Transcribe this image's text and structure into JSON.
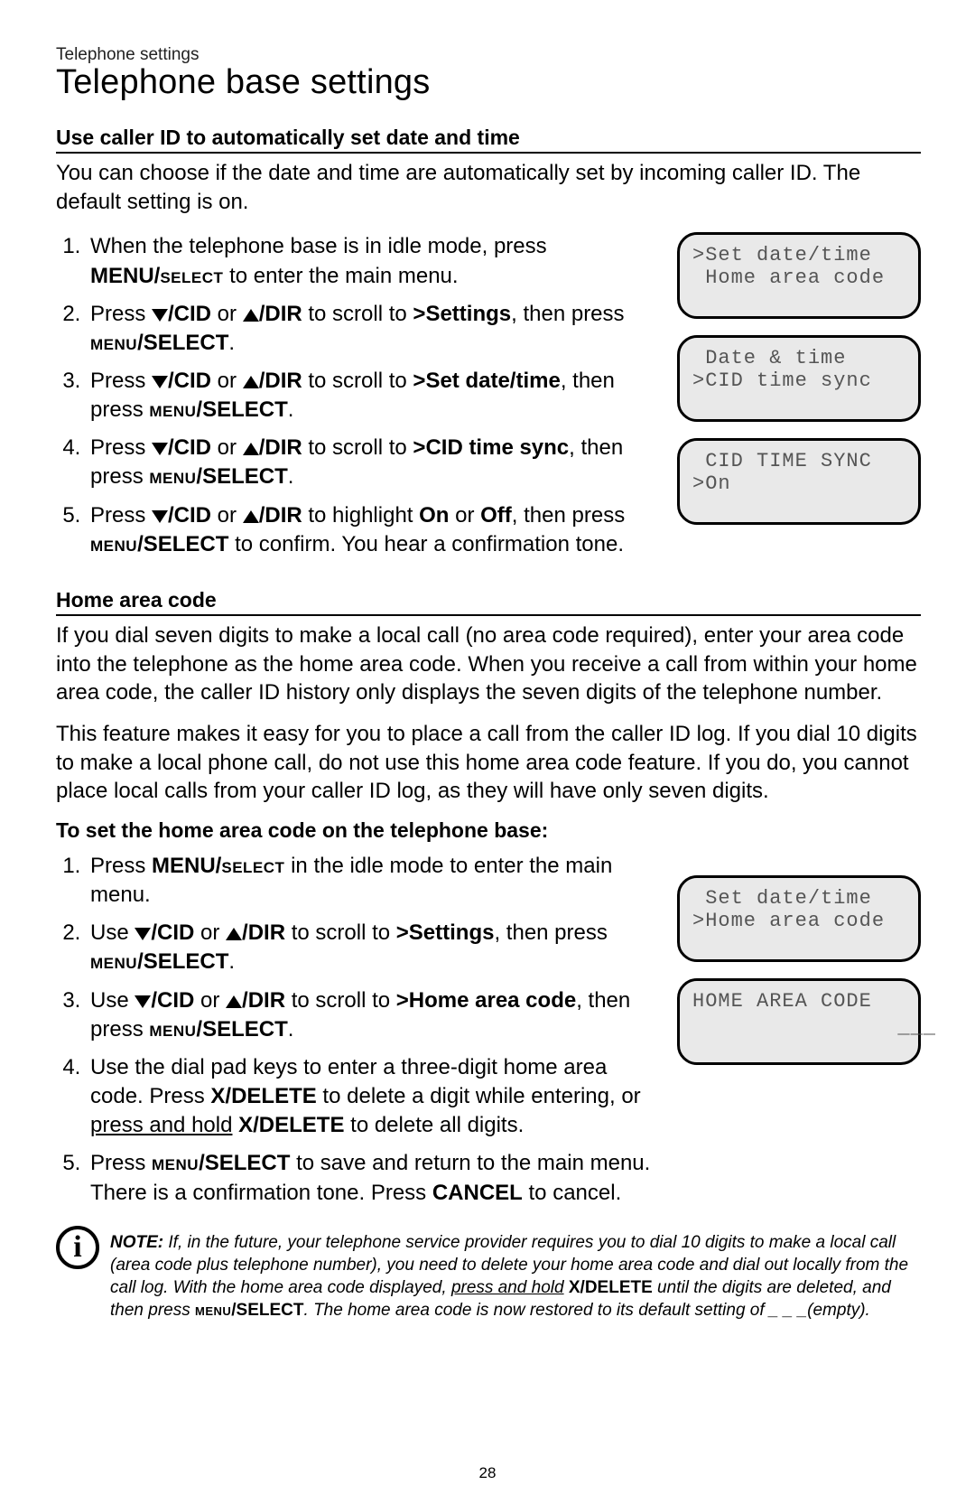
{
  "breadcrumb": "Telephone settings",
  "title": "Telephone base settings",
  "page_number": "28",
  "section1": {
    "heading": "Use caller ID to automatically set date and time",
    "intro": "You can choose if the date and time are automatically set by incoming caller ID. The default setting is on.",
    "step1_a": "When the telephone base is in idle mode, press ",
    "step1_menu": "MENU/",
    "step1_select": "select",
    "step1_b": " to enter the main menu.",
    "step_press": "Press ",
    "cid": "/CID",
    "or": " or ",
    "dir": "/DIR",
    "scroll_to": " to scroll to ",
    "settings": ">Settings",
    "then_press": ", then press ",
    "menu_small": "menu",
    "select_big": "/SELECT",
    "period": ".",
    "set_date_time": ">Set date/time",
    "cid_time_sync": ">CID time sync",
    "highlight": " to highlight ",
    "on": "On",
    "off": "Off",
    "confirm_tail": " to confirm. You hear a confirmation tone.",
    "then_press2": ", then press ",
    "lcd1_l1": ">Set date/time",
    "lcd1_l2": " Home area code",
    "lcd2_l1": " Date & time",
    "lcd2_l2": ">CID time sync",
    "lcd3_l1": " CID TIME SYNC",
    "lcd3_l2": ">On"
  },
  "section2": {
    "heading": "Home area code",
    "para1": "If you dial seven digits to make a local call (no area code required), enter your area code into the telephone as the home area code. When you receive a call from within your home area code, the caller ID history only displays the seven digits of the telephone number.",
    "para2": "This feature makes it easy for you to place a call from the caller ID log. If you dial 10 digits to make a local phone call, do not use this home area code feature. If you do, you cannot place local calls from your caller ID log, as they will have only seven digits.",
    "subheading": "To set the home area code on the telephone base:",
    "step1_a": "Press ",
    "step1_menu": "MENU/",
    "step1_select": "select",
    "step1_b": " in the idle mode to enter the main menu.",
    "use": "Use ",
    "home_area_code": ">Home area code",
    "step4_a": "Use the dial pad keys to enter a three-digit home area code. Press ",
    "xdelete": "X/DELETE",
    "step4_b": " to delete a digit while entering, or ",
    "step4_c": "press and hold",
    "step4_d": " to delete all digits.",
    "step5_a": "Press ",
    "step5_b": " to save and return to the main menu. There is a confirmation tone. Press ",
    "cancel": "CANCEL",
    "step5_c": " to cancel.",
    "lcd4_l1": " Set date/time",
    "lcd4_l2": ">Home area code",
    "lcd5_l1": "HOME AREA CODE",
    "lcd5_l2": "___"
  },
  "note": {
    "label": "NOTE:",
    "t1": " If, in the future, your telephone service provider requires you to dial 10 digits to make a local call (area code plus telephone number), you need to delete your home area code and dial out locally from the call log. With the home area code displayed, ",
    "t2": "press and hold",
    "t3": " X/DELETE",
    "t4": " until the digits are deleted, and then press ",
    "menu_small": "menu",
    "select_big": "/SELECT",
    "t5": ". The home area code is now restored to its default setting of _ _ _(empty)."
  }
}
